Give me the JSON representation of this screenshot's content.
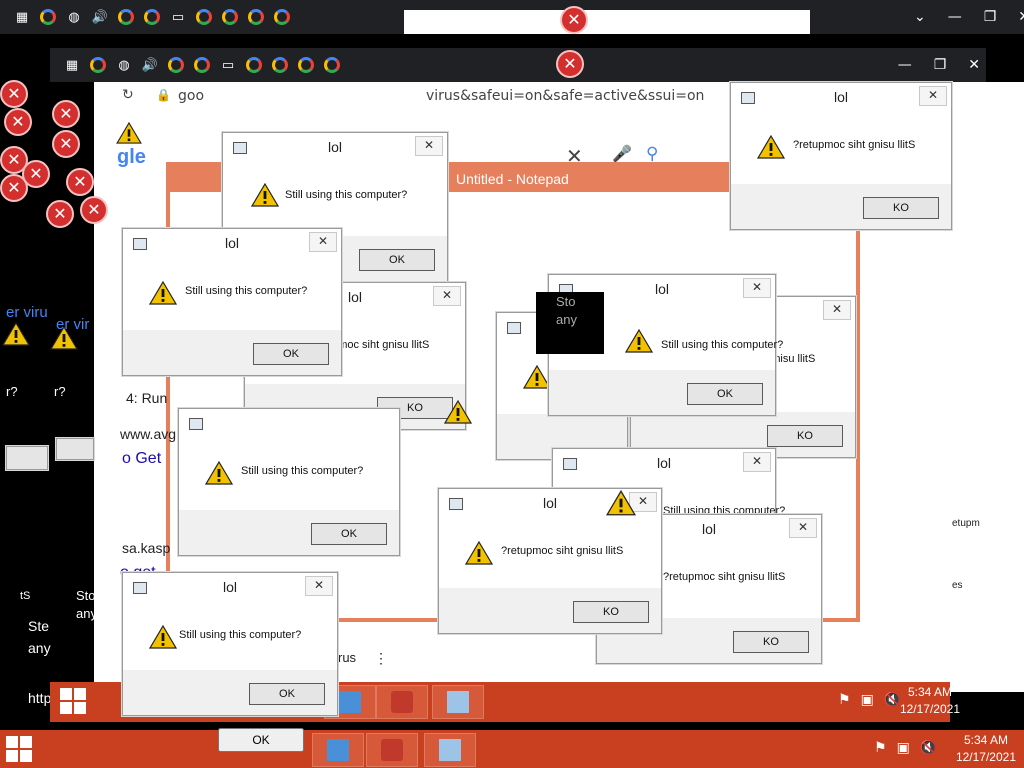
{
  "dialog_title": "lol",
  "dialog_message": "Still using this computer?",
  "dialog_message_reversed": "?retupmoc siht gnisu llitS",
  "ok_label": "OK",
  "ok_label_reversed": "KO",
  "notepad_title": "Untitled - Notepad",
  "browser": {
    "address_fragment": "virus&safeui=on&safe=active&ssui=on",
    "address_prefix": "goo",
    "google_fragment": "gle"
  },
  "fragments": {
    "run": "4: Run",
    "avg": "www.avg",
    "goget": "o Get",
    "kaspersky": "sa.kasp",
    "goget2": "o get",
    "virus1": "er viru",
    "virus2": "er vir",
    "stop": "Sto",
    "any": "any",
    "ste": "Ste",
    "any2": "any",
    "rus": "rus",
    "qmark": "r?",
    "qmark2": "r?",
    "https": "http",
    "retupm": "etupm",
    "s_frag": "es",
    "tS": "tS"
  },
  "tray": {
    "time": "5:34 AM",
    "date": "12/17/2021",
    "time2": "5:34 AM",
    "date2": "12/17/2021"
  },
  "colors": {
    "taskbar": "#c8401f",
    "notepad_border": "#e57f5c",
    "chrome_dark": "#202124"
  }
}
